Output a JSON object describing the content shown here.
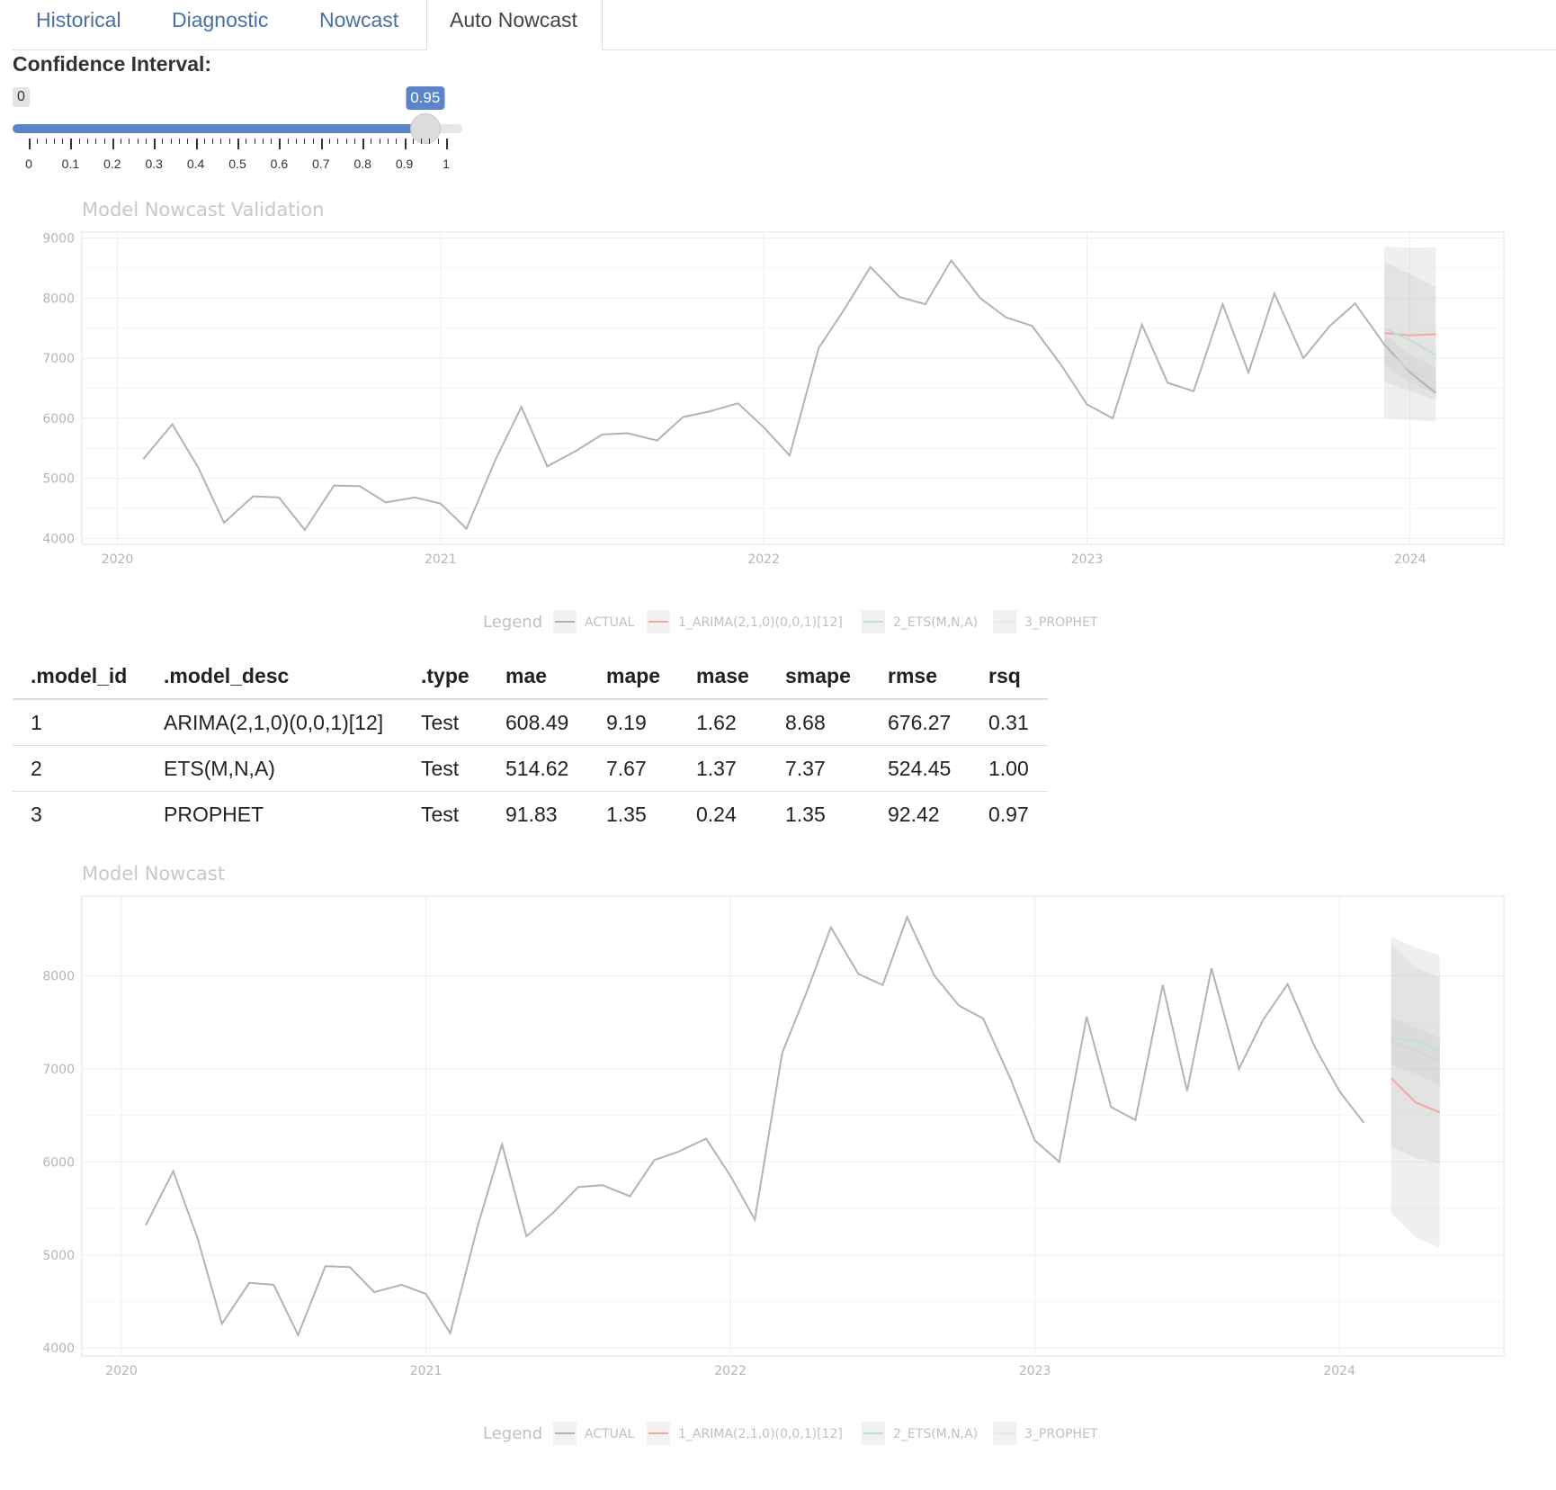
{
  "tabs": [
    {
      "label": "Historical"
    },
    {
      "label": "Diagnostic"
    },
    {
      "label": "Nowcast"
    },
    {
      "label": "Auto Nowcast",
      "active": true
    }
  ],
  "slider": {
    "label": "Confidence Interval:",
    "min_label": "0",
    "value_label": "0.95",
    "value": 0.95,
    "min": 0,
    "max": 1,
    "tick_labels": [
      "0",
      "0.1",
      "0.2",
      "0.3",
      "0.4",
      "0.5",
      "0.6",
      "0.7",
      "0.8",
      "0.9",
      "1"
    ],
    "accent": "#5c85c7"
  },
  "legend": {
    "title": "Legend",
    "items": [
      "ACTUAL",
      "1_ARIMA(2,1,0)(0,0,1)[12]",
      "2_ETS(M,N,A)",
      "3_PROPHET"
    ],
    "colors": [
      "#b3b3b3",
      "#f4a6a0",
      "#bfe0d6",
      "#e8e8e8"
    ]
  },
  "table": {
    "headers": [
      ".model_id",
      ".model_desc",
      ".type",
      "mae",
      "mape",
      "mase",
      "smape",
      "rmse",
      "rsq"
    ],
    "rows": [
      [
        "1",
        "ARIMA(2,1,0)(0,0,1)[12]",
        "Test",
        "608.49",
        "9.19",
        "1.62",
        "8.68",
        "676.27",
        "0.31"
      ],
      [
        "2",
        "ETS(M,N,A)",
        "Test",
        "514.62",
        "7.67",
        "1.37",
        "7.37",
        "524.45",
        "1.00"
      ],
      [
        "3",
        "PROPHET",
        "Test",
        "91.83",
        "1.35",
        "0.24",
        "1.35",
        "92.42",
        "0.97"
      ]
    ]
  },
  "chart_data": [
    {
      "type": "line",
      "title": "Model Nowcast Validation",
      "xlabel": "",
      "ylabel": "",
      "x_ticks": [
        "2020",
        "2021",
        "2022",
        "2023",
        "2024"
      ],
      "y_ticks": [
        4000,
        5000,
        6000,
        7000,
        8000,
        9000
      ],
      "xlim": [
        2019.89,
        2024.29
      ],
      "ylim": [
        3900,
        9100
      ],
      "series": [
        {
          "name": "ACTUAL",
          "color": "#b3b3b3",
          "x": [
            2020.08,
            2020.17,
            2020.25,
            2020.33,
            2020.42,
            2020.5,
            2020.58,
            2020.67,
            2020.75,
            2020.83,
            2020.92,
            2021.0,
            2021.08,
            2021.17,
            2021.25,
            2021.33,
            2021.42,
            2021.5,
            2021.58,
            2021.67,
            2021.75,
            2021.83,
            2021.92,
            2022.0,
            2022.08,
            2022.17,
            2022.25,
            2022.33,
            2022.42,
            2022.5,
            2022.58,
            2022.67,
            2022.75,
            2022.83,
            2022.92,
            2023.0,
            2023.08,
            2023.17,
            2023.25,
            2023.33,
            2023.42,
            2023.5,
            2023.58,
            2023.67,
            2023.75,
            2023.83,
            2023.92,
            2024.0,
            2024.08
          ],
          "y": [
            5320,
            5900,
            5180,
            4260,
            4700,
            4680,
            4140,
            4880,
            4870,
            4600,
            4680,
            4580,
            4160,
            5310,
            6190,
            5200,
            5460,
            5730,
            5750,
            5630,
            6020,
            6110,
            6250,
            5850,
            5380,
            7170,
            7820,
            8520,
            8020,
            7900,
            8630,
            8000,
            7680,
            7540,
            6890,
            6230,
            6000,
            7560,
            6590,
            6450,
            7900,
            6760,
            8080,
            7000,
            7530,
            7910,
            7230,
            6760,
            6420
          ]
        },
        {
          "name": "1_ARIMA(2,1,0)(0,0,1)[12]",
          "color": "#f4a6a0",
          "x": [
            2023.92,
            2024.0,
            2024.08
          ],
          "y": [
            7420,
            7380,
            7400
          ],
          "band_lo": [
            6000,
            5970,
            5950
          ],
          "band_hi": [
            8860,
            8840,
            8850
          ]
        },
        {
          "name": "2_ETS(M,N,A)",
          "color": "#bfe0d6",
          "x": [
            2023.92,
            2024.0,
            2024.08
          ],
          "y": [
            7500,
            7300,
            7050
          ],
          "band_lo": [
            6600,
            6450,
            6300
          ],
          "band_hi": [
            8600,
            8400,
            8180
          ]
        },
        {
          "name": "3_PROPHET",
          "color": "#d6d6d6",
          "x": [
            2023.92,
            2024.0,
            2024.08
          ],
          "y": [
            7150,
            6800,
            6600
          ],
          "band_lo": [
            6900,
            6600,
            6400
          ],
          "band_hi": [
            7400,
            7050,
            6850
          ]
        }
      ]
    },
    {
      "type": "line",
      "title": "Model Nowcast",
      "xlabel": "",
      "ylabel": "",
      "x_ticks": [
        "2020",
        "2021",
        "2022",
        "2023",
        "2024"
      ],
      "y_ticks": [
        4000,
        5000,
        6000,
        7000,
        8000
      ],
      "xlim": [
        2019.87,
        2024.54
      ],
      "ylim": [
        3915,
        8855
      ],
      "series": [
        {
          "name": "ACTUAL",
          "color": "#b3b3b3",
          "x": [
            2020.08,
            2020.17,
            2020.25,
            2020.33,
            2020.42,
            2020.5,
            2020.58,
            2020.67,
            2020.75,
            2020.83,
            2020.92,
            2021.0,
            2021.08,
            2021.17,
            2021.25,
            2021.33,
            2021.42,
            2021.5,
            2021.58,
            2021.67,
            2021.75,
            2021.83,
            2021.92,
            2022.0,
            2022.08,
            2022.17,
            2022.25,
            2022.33,
            2022.42,
            2022.5,
            2022.58,
            2022.67,
            2022.75,
            2022.83,
            2022.92,
            2023.0,
            2023.08,
            2023.17,
            2023.25,
            2023.33,
            2023.42,
            2023.5,
            2023.58,
            2023.67,
            2023.75,
            2023.83,
            2023.92,
            2024.0,
            2024.08
          ],
          "y": [
            5320,
            5900,
            5180,
            4260,
            4700,
            4680,
            4140,
            4880,
            4870,
            4600,
            4680,
            4580,
            4160,
            5310,
            6190,
            5200,
            5460,
            5730,
            5750,
            5630,
            6020,
            6110,
            6250,
            5850,
            5380,
            7170,
            7820,
            8520,
            8020,
            7900,
            8630,
            8000,
            7680,
            7540,
            6890,
            6230,
            6000,
            7560,
            6590,
            6450,
            7900,
            6760,
            8080,
            7000,
            7530,
            7910,
            7230,
            6760,
            6420
          ]
        },
        {
          "name": "1_ARIMA(2,1,0)(0,0,1)[12]",
          "color": "#f4a6a0",
          "x": [
            2024.17,
            2024.25,
            2024.33
          ],
          "y": [
            6900,
            6640,
            6530
          ],
          "band_lo": [
            5450,
            5190,
            5080
          ],
          "band_hi": [
            8350,
            8090,
            7980
          ]
        },
        {
          "name": "2_ETS(M,N,A)",
          "color": "#bfe0d6",
          "x": [
            2024.17,
            2024.25,
            2024.33
          ],
          "y": [
            7330,
            7300,
            7200
          ],
          "band_lo": [
            6160,
            6050,
            5980
          ],
          "band_hi": [
            8420,
            8300,
            8220
          ]
        },
        {
          "name": "3_PROPHET",
          "color": "#d6d6d6",
          "x": [
            2024.17,
            2024.25,
            2024.33
          ],
          "y": [
            7290,
            7200,
            7080
          ],
          "band_lo": [
            7040,
            6950,
            6830
          ],
          "band_hi": [
            7540,
            7450,
            7330
          ]
        }
      ]
    }
  ]
}
